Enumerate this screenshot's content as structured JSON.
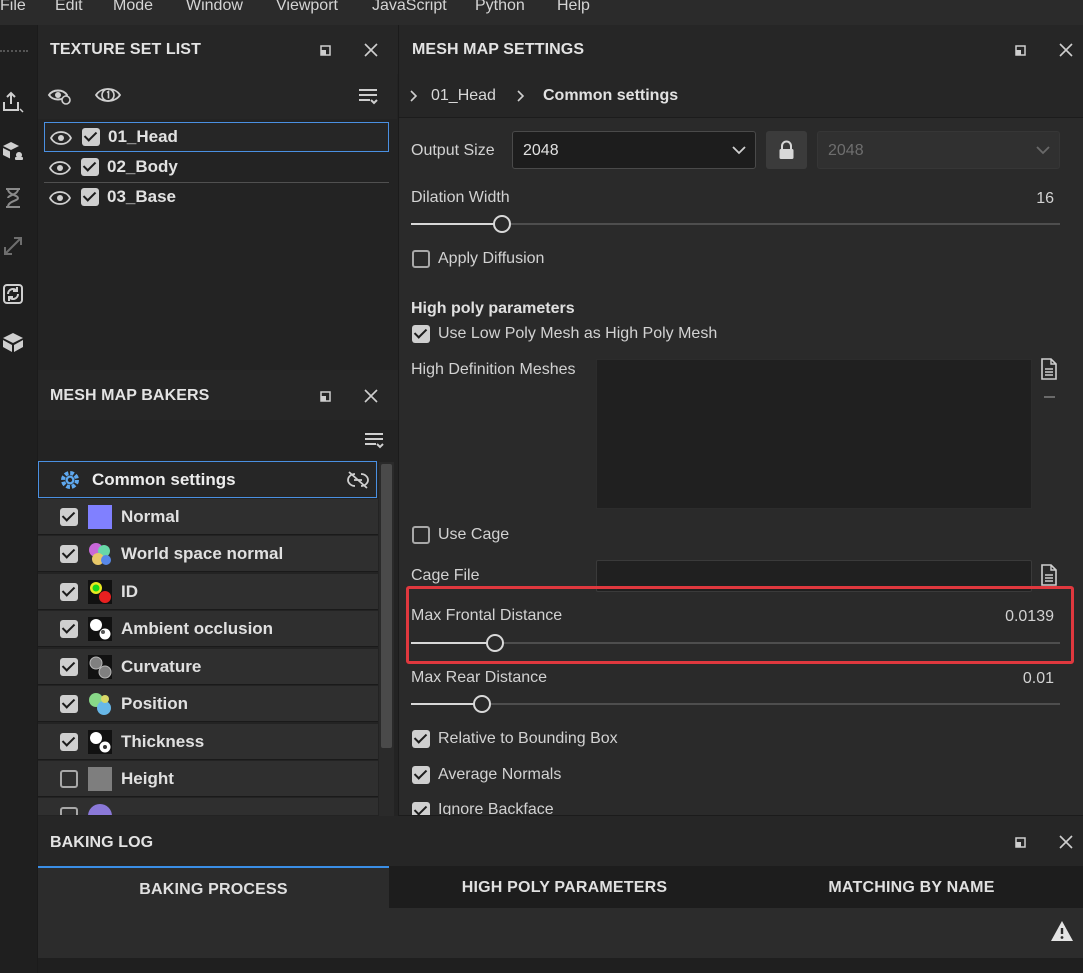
{
  "menu": [
    "File",
    "Edit",
    "Mode",
    "Window",
    "Viewport",
    "JavaScript",
    "Python",
    "Help"
  ],
  "toolbar_icons": [
    "export-icon",
    "bake-icon",
    "history-icon",
    "resize-icon",
    "refresh-icon",
    "mesh-icon"
  ],
  "texture_set_list": {
    "title": "TEXTURE SET LIST",
    "items": [
      {
        "name": "01_Head",
        "visible": true,
        "checked": true,
        "selected": true
      },
      {
        "name": "02_Body",
        "visible": true,
        "checked": true,
        "selected": false
      },
      {
        "name": "03_Base",
        "visible": true,
        "checked": true,
        "selected": false
      }
    ]
  },
  "mesh_map_bakers": {
    "title": "MESH MAP BAKERS",
    "common_settings_label": "Common settings",
    "items": [
      {
        "label": "Normal",
        "checked": true,
        "icon": "normal-map-icon"
      },
      {
        "label": "World space normal",
        "checked": true,
        "icon": "world-space-normal-icon"
      },
      {
        "label": "ID",
        "checked": true,
        "icon": "id-map-icon"
      },
      {
        "label": "Ambient occlusion",
        "checked": true,
        "icon": "ambient-occlusion-icon"
      },
      {
        "label": "Curvature",
        "checked": true,
        "icon": "curvature-icon"
      },
      {
        "label": "Position",
        "checked": true,
        "icon": "position-icon"
      },
      {
        "label": "Thickness",
        "checked": true,
        "icon": "thickness-icon"
      },
      {
        "label": "Height",
        "checked": false,
        "icon": "height-icon"
      }
    ]
  },
  "mesh_map_settings": {
    "title": "MESH MAP SETTINGS",
    "breadcrumb": [
      "01_Head",
      "Common settings"
    ],
    "output_size_label": "Output Size",
    "output_size_value": "2048",
    "output_size_locked_value": "2048",
    "dilation_width_label": "Dilation Width",
    "dilation_width_value": "16",
    "dilation_width_fraction": 0.14,
    "apply_diffusion_label": "Apply Diffusion",
    "high_poly_section": "High poly parameters",
    "use_low_poly_label": "Use Low Poly Mesh as High Poly Mesh",
    "high_def_meshes_label": "High Definition Meshes",
    "use_cage_label": "Use Cage",
    "cage_file_label": "Cage File",
    "max_frontal_label": "Max Frontal Distance",
    "max_frontal_value": "0.0139",
    "max_frontal_fraction": 0.13,
    "max_rear_label": "Max Rear Distance",
    "max_rear_value": "0.01",
    "max_rear_fraction": 0.11,
    "relative_bbox_label": "Relative to Bounding Box",
    "average_normals_label": "Average Normals",
    "ignore_backface_label": "Ignore Backface"
  },
  "baking_log": {
    "title": "BAKING LOG",
    "tabs": [
      "BAKING PROCESS",
      "HIGH POLY PARAMETERS",
      "MATCHING BY NAME"
    ],
    "active_tab": 0
  },
  "colors": {
    "highlight": "#e0383e",
    "selection": "#4a90e2",
    "accent_tab": "#3a8ee6"
  }
}
